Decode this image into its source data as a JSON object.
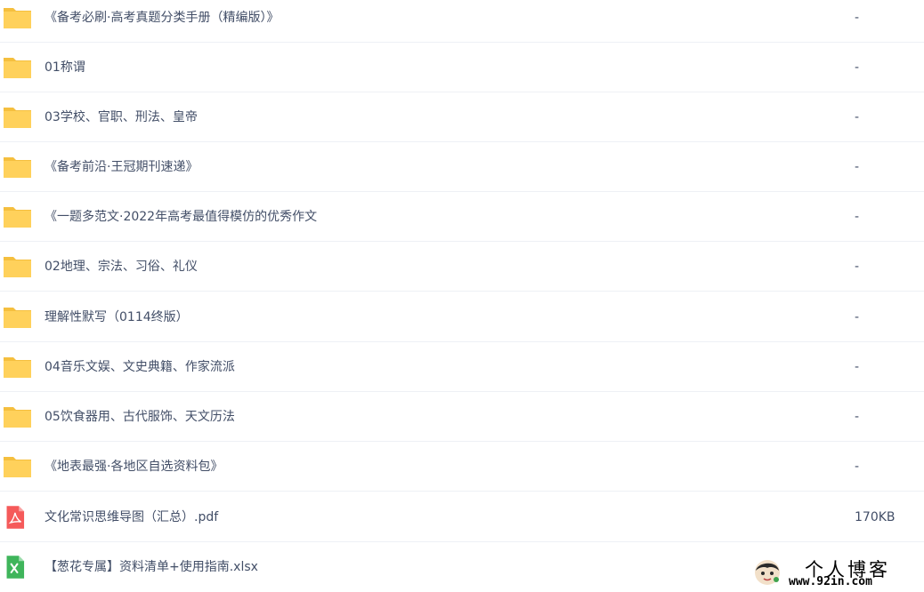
{
  "files": [
    {
      "name": "《备考必刷·高考真题分类手册（精编版）》",
      "size": "-",
      "icon": "folder-icon"
    },
    {
      "name": "01称谓",
      "size": "-",
      "icon": "folder-icon"
    },
    {
      "name": "03学校、官职、刑法、皇帝",
      "size": "-",
      "icon": "folder-icon"
    },
    {
      "name": "《备考前沿·王冠期刊速递》",
      "size": "-",
      "icon": "folder-icon"
    },
    {
      "name": "《一题多范文·2022年高考最值得模仿的优秀作文",
      "size": "-",
      "icon": "folder-icon"
    },
    {
      "name": "02地理、宗法、习俗、礼仪",
      "size": "-",
      "icon": "folder-icon"
    },
    {
      "name": "理解性默写（0114终版）",
      "size": "-",
      "icon": "folder-icon"
    },
    {
      "name": "04音乐文娱、文史典籍、作家流派",
      "size": "-",
      "icon": "folder-icon"
    },
    {
      "name": "05饮食器用、古代服饰、天文历法",
      "size": "-",
      "icon": "folder-icon"
    },
    {
      "name": "《地表最强·各地区自选资料包》",
      "size": "-",
      "icon": "folder-icon"
    },
    {
      "name": "文化常识思维导图（汇总）.pdf",
      "size": "170KB",
      "icon": "pdf-icon"
    },
    {
      "name": "【葱花专属】资料清单+使用指南.xlsx",
      "size": "",
      "icon": "excel-icon"
    }
  ],
  "watermark": {
    "title": "个人博客",
    "url": "www.92in.com"
  },
  "colors": {
    "folder": "#ffd15b",
    "folder_tab": "#f5bf3e",
    "pdf": "#f55a5a",
    "excel": "#3fb55b",
    "text": "#424e67",
    "divider": "#eef0f5"
  }
}
